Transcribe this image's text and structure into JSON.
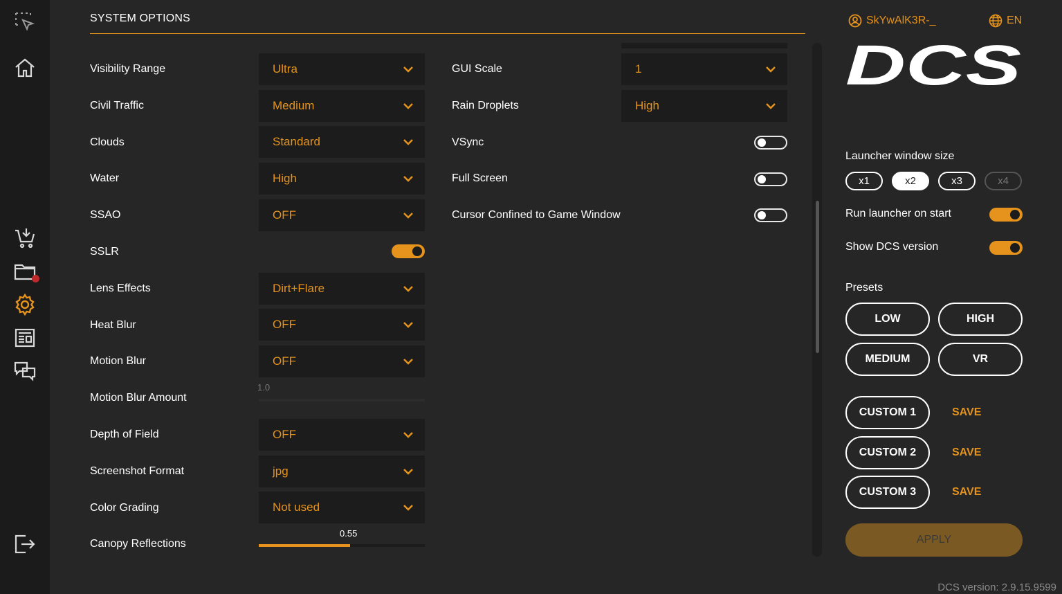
{
  "section_title": "SYSTEM OPTIONS",
  "left_settings": [
    {
      "label": "Visibility Range",
      "type": "select",
      "value": "Ultra"
    },
    {
      "label": "Civil Traffic",
      "type": "select",
      "value": "Medium"
    },
    {
      "label": "Clouds",
      "type": "select",
      "value": "Standard"
    },
    {
      "label": "Water",
      "type": "select",
      "value": "High"
    },
    {
      "label": "SSAO",
      "type": "select",
      "value": "OFF"
    },
    {
      "label": "SSLR",
      "type": "toggle",
      "value": "on"
    },
    {
      "label": "Lens Effects",
      "type": "select",
      "value": "Dirt+Flare"
    },
    {
      "label": "Heat Blur",
      "type": "select",
      "value": "OFF"
    },
    {
      "label": "Motion Blur",
      "type": "select",
      "value": "OFF"
    },
    {
      "label": "Motion Blur Amount",
      "type": "slider",
      "value": "1.0"
    },
    {
      "label": "Depth of Field",
      "type": "select",
      "value": "OFF"
    },
    {
      "label": "Screenshot Format",
      "type": "select",
      "value": "jpg"
    },
    {
      "label": "Color Grading",
      "type": "select",
      "value": "Not used"
    },
    {
      "label": "Canopy Reflections",
      "type": "slider",
      "value": "0.55",
      "fraction": 0.55
    }
  ],
  "right_settings": [
    {
      "label": "GUI Scale",
      "type": "select",
      "value": "1"
    },
    {
      "label": "Rain Droplets",
      "type": "select",
      "value": "High"
    },
    {
      "label": "VSync",
      "type": "toggle",
      "value": "off"
    },
    {
      "label": "Full Screen",
      "type": "toggle",
      "value": "off"
    },
    {
      "label": "Cursor Confined to Game Window",
      "type": "toggle",
      "value": "off"
    }
  ],
  "user": {
    "name": "SkYwAlK3R-_",
    "icon": "user-circle-icon"
  },
  "language": {
    "code": "EN",
    "icon": "globe-icon"
  },
  "logo_text": "DCS",
  "launcher_window_size": {
    "label": "Launcher window size",
    "options": [
      "x1",
      "x2",
      "x3",
      "x4"
    ],
    "selected": "x2"
  },
  "run_on_start": {
    "label": "Run launcher on start",
    "value": "on"
  },
  "show_version": {
    "label": "Show DCS version",
    "value": "on"
  },
  "presets": {
    "label": "Presets",
    "buttons": [
      "LOW",
      "HIGH",
      "MEDIUM",
      "VR"
    ],
    "custom": [
      "CUSTOM 1",
      "CUSTOM 2",
      "CUSTOM 3"
    ],
    "save_label": "SAVE"
  },
  "apply_label": "APPLY",
  "version_text": "DCS version: 2.9.15.9599",
  "sidebar_icons": [
    "select-cursor-icon",
    "home-icon",
    "cart-download-icon",
    "folder-icon",
    "gear-icon",
    "news-icon",
    "chat-icon",
    "logout-icon"
  ],
  "colors": {
    "accent": "#e5931c",
    "background": "#262626",
    "sidebar": "#1b1b1b",
    "field": "#1c1c1c"
  }
}
